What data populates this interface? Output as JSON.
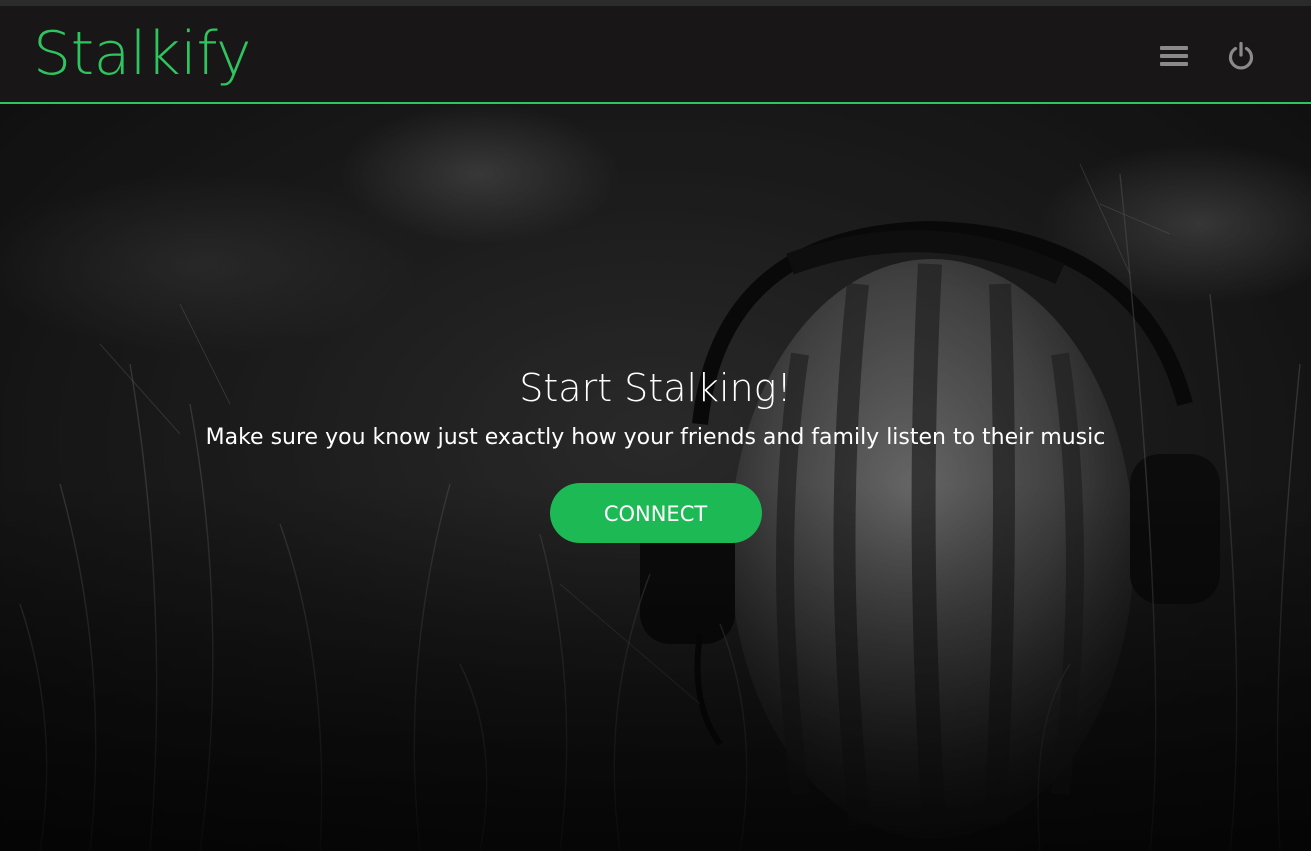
{
  "navbar": {
    "brand": "Stalkify",
    "menu_icon": "hamburger-menu-icon",
    "power_icon": "power-icon"
  },
  "hero": {
    "background_image": "watermelon-with-headphones-in-grass",
    "title": "Start Stalking!",
    "subtitle": "Make sure you know just exactly how your friends and family listen to their music",
    "connect_label": "CONNECT"
  },
  "colors": {
    "accent": "#1db954",
    "brand": "#2ec55f",
    "navbar_bg": "#181616",
    "icon_gray": "#8a8a8a"
  }
}
